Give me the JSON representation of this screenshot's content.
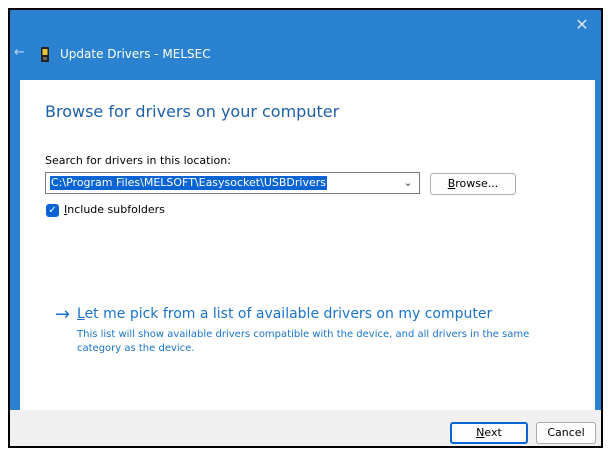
{
  "window": {
    "title": "Update Drivers - MELSEC",
    "close_glyph": "✕",
    "back_glyph": "←"
  },
  "page": {
    "heading": "Browse for drivers on your computer",
    "search_label": "Search for drivers in this location:",
    "path_value": "C:\\Program Files\\MELSOFT\\Easysocket\\USBDrivers",
    "browse_label_prefix": "B",
    "browse_label_rest": "rowse...",
    "include_subfolders_prefix": "I",
    "include_subfolders_rest": "nclude subfolders",
    "include_subfolders_checked": true,
    "pick_prefix": "L",
    "pick_rest": "et me pick from a list of available drivers on my computer",
    "pick_description": "This list will show available drivers compatible with the device, and all drivers in the same category as the device."
  },
  "footer": {
    "next_prefix": "N",
    "next_rest": "ext",
    "cancel_label": "Cancel"
  },
  "colors": {
    "titlebar": "#2b82d0",
    "heading": "#1f5fa8",
    "link": "#1a73c9",
    "accent": "#0a64d4",
    "footer": "#f0f0f0"
  },
  "icons": {
    "close": "close-icon",
    "back": "back-arrow-icon",
    "device": "device-icon",
    "dropdown": "chevron-down-icon",
    "checkbox": "checkmark-icon",
    "pick": "arrow-right-icon"
  }
}
